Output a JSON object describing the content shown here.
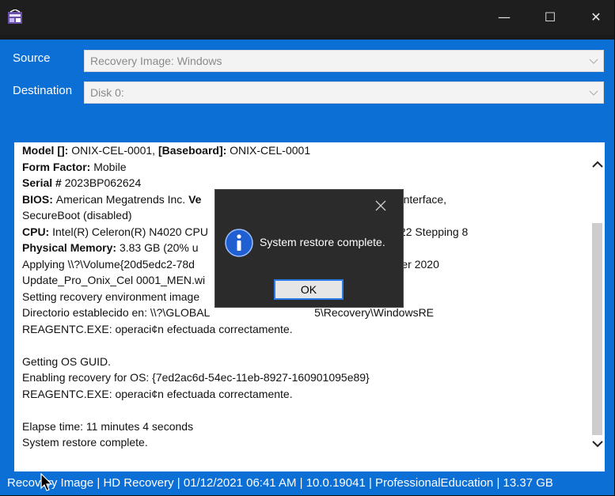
{
  "titlebar": {
    "icons": {
      "app": "recovery-app-icon",
      "minimize": "minimize-icon",
      "maximize": "maximize-icon",
      "close": "close-icon"
    },
    "minimize_glyph": "—",
    "maximize_glyph": "☐",
    "close_glyph": "✕"
  },
  "form": {
    "source_label": "Source",
    "source_value": "Recovery Image: Windows",
    "destination_label": "Destination",
    "destination_value": "Disk 0:"
  },
  "log": {
    "lines": [
      [
        {
          "b": true,
          "t": "Model []: "
        },
        {
          "t": "ONIX-CEL-0001, "
        },
        {
          "b": true,
          "t": "[Baseboard]: "
        },
        {
          "t": "ONIX-CEL-0001"
        }
      ],
      [
        {
          "b": true,
          "t": "Form Factor: "
        },
        {
          "t": "Mobile"
        }
      ],
      [
        {
          "b": true,
          "t": "Serial # "
        },
        {
          "t": "2023BP062624"
        }
      ],
      [
        {
          "b": true,
          "t": "BIOS: "
        },
        {
          "t": "American Megatrends Inc. "
        },
        {
          "b": true,
          "t": "Ve"
        },
        {
          "t": "                                          EFI Firmware Interface,"
        }
      ],
      [
        {
          "t": "SecureBoot (disabled)"
        }
      ],
      [
        {
          "b": true,
          "t": "CPU: "
        },
        {
          "t": "Intel(R) Celeron(R) N4020 CPU"
        },
        {
          "t": "                                          ily 6 Model 122 Stepping 8"
        }
      ],
      [
        {
          "b": true,
          "t": "Physical Memory: "
        },
        {
          "t": "3.83 GB (20% u"
        }
      ],
      [
        {
          "t": "Applying \\\\?\\Volume{20d5edc2-78d"
        },
        {
          "t": "                                    \\Windows 10 October 2020"
        }
      ],
      [
        {
          "t": "Update_Pro_Onix_Cel 0001_MEN.wi"
        }
      ],
      [
        {
          "t": "Setting recovery environment image"
        }
      ],
      [
        {
          "t": "Directorio establecido en: \\\\?\\GLOBAL"
        },
        {
          "t": "                                  5\\Recovery\\WindowsRE"
        }
      ],
      [
        {
          "t": "REAGENTC.EXE: operaci¢n efectuada correctamente."
        }
      ],
      [
        {
          "t": ""
        }
      ],
      [
        {
          "t": "Getting OS GUID."
        }
      ],
      [
        {
          "t": "Enabling recovery for OS: {7ed2ac6d-54ec-11eb-8927-160901095e89}"
        }
      ],
      [
        {
          "t": "REAGENTC.EXE: operaci¢n efectuada correctamente."
        }
      ],
      [
        {
          "t": ""
        }
      ],
      [
        {
          "t": "Elapse time: 11 minutes 4 seconds"
        }
      ],
      [
        {
          "t": "System restore complete."
        }
      ]
    ]
  },
  "statusbar": {
    "text": "Recovery Image | HD Recovery | 01/12/2021 06:41 AM | 10.0.19041 | ProfessionalEducation | 13.37 GB"
  },
  "dialog": {
    "message": "System restore complete.",
    "ok_label": "OK",
    "icons": {
      "info": "info-icon",
      "close": "close-icon"
    }
  },
  "colors": {
    "accent_blue": "#0b6fd6",
    "dialog_bg": "#2b2b2b",
    "titlebar_bg": "#1e1e1e"
  }
}
